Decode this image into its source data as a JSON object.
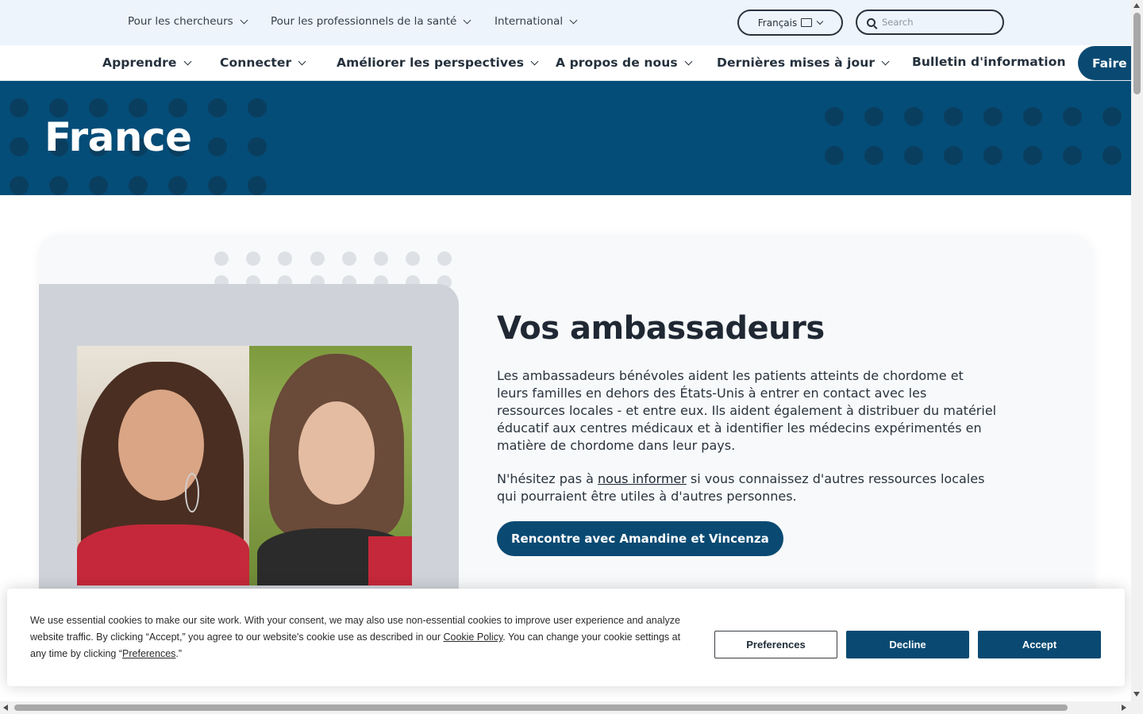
{
  "utility_nav": {
    "items": [
      {
        "label": "Pour les chercheurs"
      },
      {
        "label": "Pour les professionnels de la santé"
      },
      {
        "label": "International"
      }
    ],
    "language": {
      "label": "Français"
    },
    "search": {
      "placeholder": "Search"
    }
  },
  "main_nav": {
    "items": [
      {
        "label": "Apprendre"
      },
      {
        "label": "Connecter"
      },
      {
        "label": "Améliorer les perspectives"
      },
      {
        "label": "A propos de nous"
      },
      {
        "label": "Dernières mises à jour"
      },
      {
        "label": "Bulletin d'information"
      }
    ],
    "cta_label": "Faire u"
  },
  "hero": {
    "title": "France"
  },
  "content": {
    "heading": "Vos ambassadeurs",
    "paragraph1": "Les ambassadeurs bénévoles aident les patients atteints de chordome et leurs familles en dehors des États-Unis à entrer en contact avec les ressources locales - et entre eux. Ils aident également à distribuer du matériel éducatif aux centres médicaux et à identifier les médecins expérimentés en matière de chordome dans leur pays.",
    "paragraph2_before": "N'hésitez pas à ",
    "paragraph2_link": "nous informer",
    "paragraph2_after": " si vous connaissez d'autres ressources locales qui pourraient être utiles à d'autres personnes.",
    "button_label": "Rencontre avec Amandine et Vincenza"
  },
  "cookie": {
    "text_before": "We use essential cookies to make our site work. With your consent, we may also use non-essential cookies to improve user experience and analyze website traffic. By clicking “Accept,” you agree to our website's cookie use as described in our ",
    "policy_link": "Cookie Policy",
    "text_middle": ". You can change your cookie settings at any time by clicking “",
    "preferences_link": "Preferences",
    "text_after": ".”",
    "preferences_label": "Preferences",
    "decline_label": "Decline",
    "accept_label": "Accept"
  },
  "colors": {
    "brand_blue": "#0a4a72",
    "hero_blue": "#044d78",
    "utility_bg": "#eef4fb"
  }
}
